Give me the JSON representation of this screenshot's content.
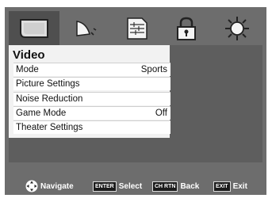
{
  "tabs": [
    {
      "icon": "picture-icon",
      "active": true
    },
    {
      "icon": "speaker-icon",
      "active": false
    },
    {
      "icon": "settings-sliders-icon",
      "active": false
    },
    {
      "icon": "lock-icon",
      "active": false
    },
    {
      "icon": "gear-icon",
      "active": false
    }
  ],
  "menu": {
    "title": "Video",
    "items": [
      {
        "label": "Mode",
        "value": "Sports"
      },
      {
        "label": "Picture Settings",
        "value": ""
      },
      {
        "label": "Noise Reduction",
        "value": ""
      },
      {
        "label": "Game Mode",
        "value": "Off"
      },
      {
        "label": "Theater Settings",
        "value": ""
      }
    ]
  },
  "footer": {
    "navigate_label": "Navigate",
    "enter_key": "ENTER",
    "select_label": "Select",
    "chrtn_key": "CH RTN",
    "back_label": "Back",
    "exit_key": "EXIT",
    "exit_label": "Exit"
  },
  "colors": {
    "frame": "#6d6d6d",
    "panel": "#5e5e5e",
    "active_tab": "#4f4f4f"
  }
}
